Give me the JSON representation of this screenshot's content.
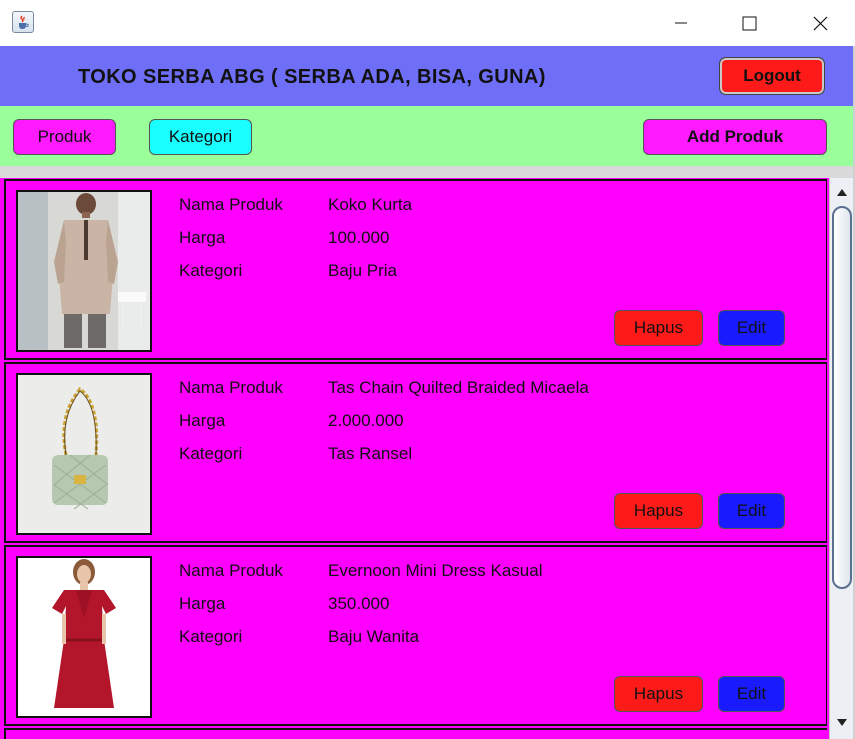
{
  "window": {
    "icon": "java-cup-icon",
    "controls": [
      "minimize-icon",
      "maximize-icon",
      "close-icon"
    ]
  },
  "header": {
    "title": "TOKO SERBA ABG ( SERBA ADA, BISA, GUNA)",
    "logout_label": "Logout"
  },
  "nav": {
    "produk_label": "Produk",
    "kategori_label": "Kategori",
    "add_label": "Add Produk"
  },
  "labels": {
    "name": "Nama Produk",
    "price": "Harga",
    "category": "Kategori",
    "delete": "Hapus",
    "edit": "Edit"
  },
  "products": [
    {
      "name": "Koko Kurta",
      "price": "100.000",
      "category": "Baju Pria",
      "image": "man-in-koko-kurta-photo"
    },
    {
      "name": "Tas Chain Quilted Braided Micaela",
      "price": "2.000.000",
      "category": "Tas Ransel",
      "image": "quilted-chain-bag-photo"
    },
    {
      "name": "Evernoon Mini Dress Kasual",
      "price": "350.000",
      "category": "Baju Wanita",
      "image": "red-mini-dress-photo"
    }
  ],
  "colors": {
    "header_bg": "#6e6ef6",
    "nav_bg": "#9aff9a",
    "card_bg": "#ff00ff",
    "produk_btn": "#ff1aff",
    "kategori_btn": "#1affff",
    "delete_btn": "#ff1a1a",
    "edit_btn": "#1a1aff",
    "logout_btn": "#ff1a1a"
  }
}
